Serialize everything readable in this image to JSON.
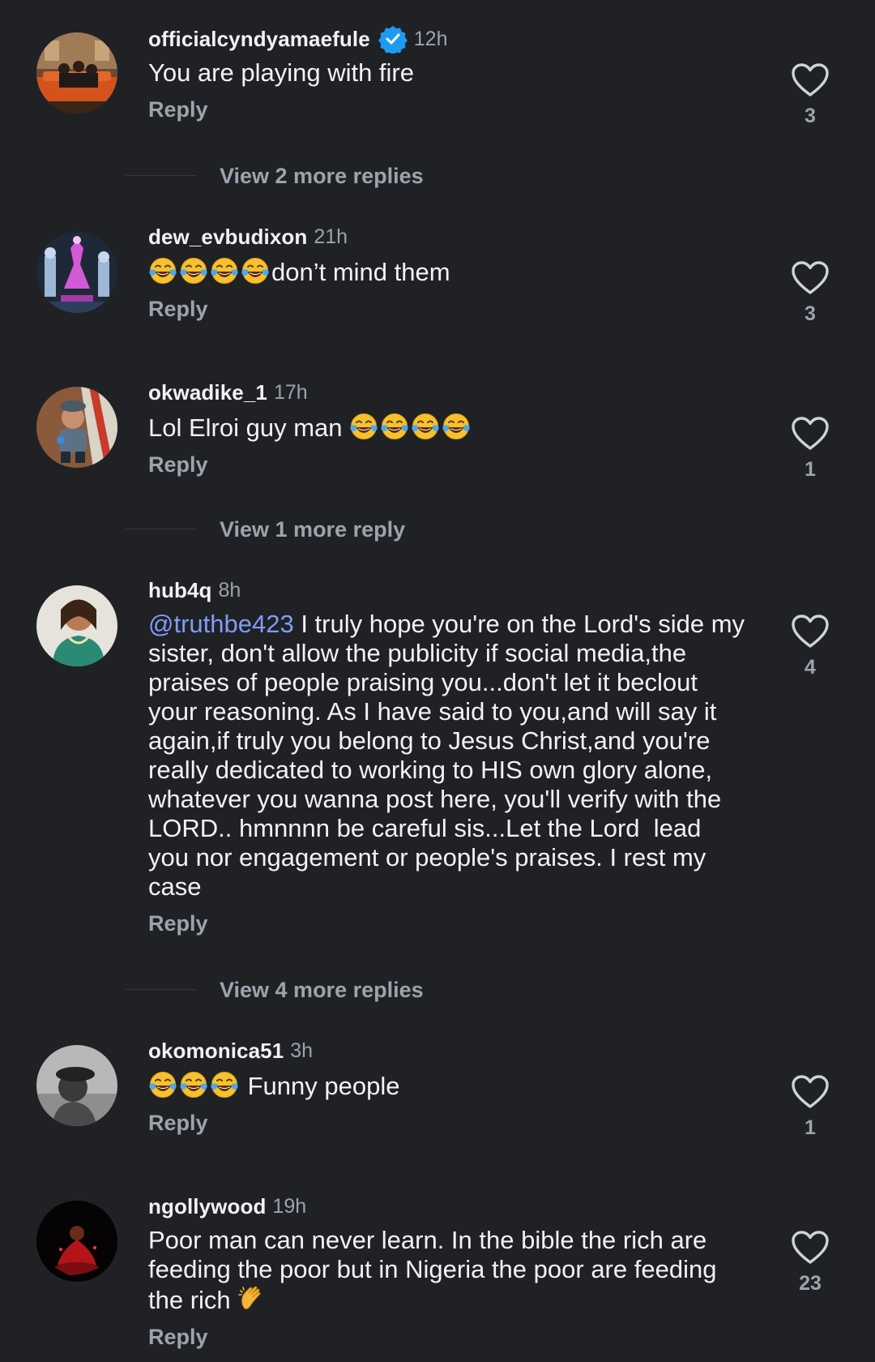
{
  "colors": {
    "background": "#202125",
    "text_primary": "#f2f2f4",
    "text_secondary": "#9da3ad",
    "mention": "#7f9cf6",
    "verified_badge": "#1d9bf0"
  },
  "comments": [
    {
      "username": "officialcyndyamaefule",
      "verified": true,
      "time": "12h",
      "text": "You are playing with fire",
      "reply_label": "Reply",
      "likes": "3",
      "view_replies": "View 2 more replies",
      "avatar_icon": "living-room-photo-avatar"
    },
    {
      "username": "dew_evbudixon",
      "time": "21h",
      "emoji_prefix": [
        "face-with-tears-of-joy",
        "face-with-tears-of-joy",
        "face-with-tears-of-joy",
        "face-with-tears-of-joy"
      ],
      "text": "don’t mind them",
      "reply_label": "Reply",
      "likes": "3",
      "avatar_icon": "chess-queen-avatar"
    },
    {
      "username": "okwadike_1",
      "time": "17h",
      "text": "Lol Elroi guy man ",
      "emoji_suffix": [
        "face-with-tears-of-joy",
        "face-with-tears-of-joy",
        "face-with-tears-of-joy",
        "face-with-tears-of-joy"
      ],
      "reply_label": "Reply",
      "likes": "1",
      "view_replies": "View 1 more reply",
      "avatar_icon": "child-with-cap-avatar"
    },
    {
      "username": "hub4q",
      "time": "8h",
      "mention": "@truthbe423",
      "text": " I truly hope you're on the Lord's side my sister, don't allow the publicity if social media,the praises of people praising you...don't let it beclout your reasoning. As I have said to you,and will say it again,if truly you belong to Jesus Christ,and you're really dedicated to working to HIS own glory alone, whatever you wanna post here, you'll verify with the LORD.. hmnnnn be careful sis...Let the Lord  lead you nor engagement or people's praises. I rest my case",
      "reply_label": "Reply",
      "likes": "4",
      "view_replies": "View 4 more replies",
      "avatar_icon": "woman-in-green-avatar"
    },
    {
      "username": "okomonica51",
      "time": "3h",
      "emoji_prefix": [
        "face-with-tears-of-joy",
        "face-with-tears-of-joy",
        "face-with-tears-of-joy"
      ],
      "text": " Funny people",
      "reply_label": "Reply",
      "likes": "1",
      "avatar_icon": "monochrome-portrait-avatar"
    },
    {
      "username": "ngollywood",
      "time": "19h",
      "text": "Poor man can never learn. In the bible the rich are feeding the poor but in Nigeria the poor are feeding the rich ",
      "emoji_suffix": [
        "clapping-hands"
      ],
      "reply_label": "Reply",
      "likes": "23",
      "avatar_icon": "red-dress-dark-avatar"
    }
  ]
}
